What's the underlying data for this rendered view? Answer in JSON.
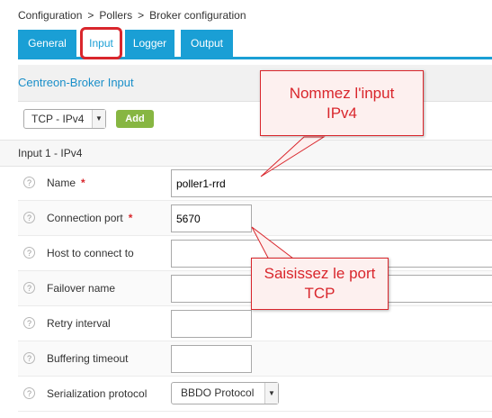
{
  "breadcrumb": {
    "items": [
      "Configuration",
      "Pollers",
      "Broker configuration"
    ],
    "separator": ">"
  },
  "tabs": [
    {
      "label": "General",
      "active": false
    },
    {
      "label": "Input",
      "active": true
    },
    {
      "label": "Logger",
      "active": false
    },
    {
      "label": "Output",
      "active": false
    }
  ],
  "section": {
    "title": "Centreon-Broker Input"
  },
  "toolbar": {
    "type_value": "TCP - IPv4",
    "add_label": "Add"
  },
  "subheader": {
    "label": "Input 1 - IPv4"
  },
  "fields": {
    "name": {
      "label": "Name",
      "required": "*",
      "value": "poller1-rrd"
    },
    "port": {
      "label": "Connection port",
      "required": "*",
      "value": "5670"
    },
    "host": {
      "label": "Host to connect to",
      "value": ""
    },
    "failover": {
      "label": "Failover name",
      "value": ""
    },
    "retry": {
      "label": "Retry interval",
      "value": ""
    },
    "buffering": {
      "label": "Buffering timeout",
      "value": ""
    },
    "serialization": {
      "label": "Serialization protocol",
      "value": "BBDO Protocol"
    }
  },
  "help_glyph": "?",
  "annotations": {
    "name_callout": [
      "Nommez l'input",
      "IPv4"
    ],
    "port_callout": [
      "Saisissez le port",
      "TCP"
    ]
  },
  "colors": {
    "tab_blue": "#1a9fd5",
    "title_blue": "#1a8fc9",
    "add_green": "#87b642",
    "callout_red": "#d9262c",
    "callout_fill": "#fdf0ef"
  }
}
